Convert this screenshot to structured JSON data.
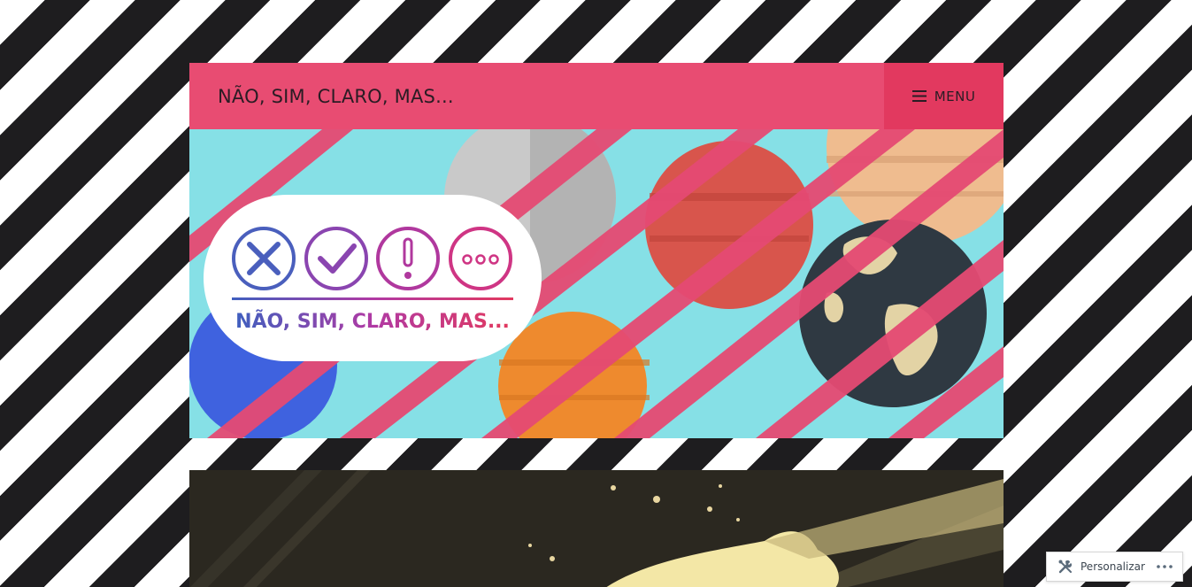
{
  "site": {
    "title": "NÃO, SIM, CLARO, MAS..."
  },
  "menu": {
    "label": "MENU",
    "icon": "hamburger-icon"
  },
  "header_image": {
    "logo_text": "NÃO, SIM, CLARO, MAS...",
    "icons": [
      "x-circle-icon",
      "check-circle-icon",
      "exclamation-circle-icon",
      "ellipsis-circle-icon"
    ]
  },
  "customizer": {
    "label": "Personalizar",
    "icon": "tools-icon",
    "more_icon": "more-dots-icon"
  },
  "colors": {
    "accent": "#e84c72",
    "menu_bg": "#e2395f",
    "stripe_dark": "#1e1d1f",
    "header_sky": "#86e0e6"
  }
}
